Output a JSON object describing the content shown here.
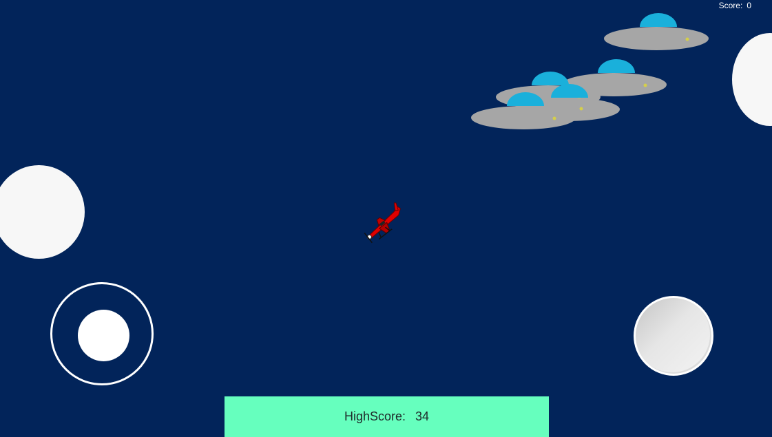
{
  "hud": {
    "score_label": "Score:",
    "score_value": "0"
  },
  "highscore": {
    "label": "HighScore:",
    "value": "34"
  },
  "colors": {
    "sky": "#02245a",
    "cloud": "#f7f7f7",
    "ufo_dome": "#1ab0db",
    "ufo_body": "#a6a6a6",
    "plane": "#e00000",
    "highscore_panel": "#66ffbe"
  },
  "entities": {
    "ufo_count": 4,
    "cloud_count": 2,
    "player": "red-airplane"
  },
  "controls": {
    "joystick": "virtual-joystick",
    "fire": "fire-button"
  }
}
